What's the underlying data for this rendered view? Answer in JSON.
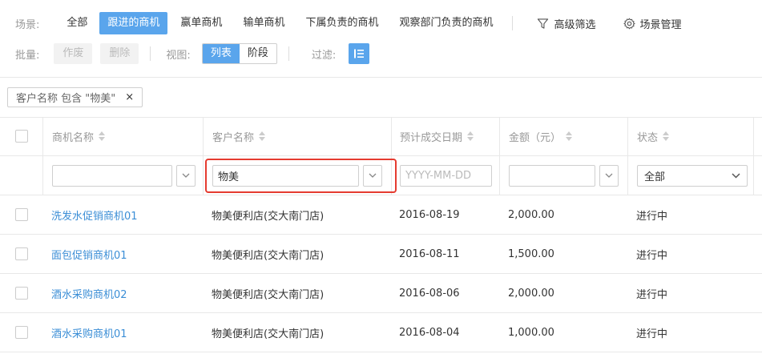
{
  "scene": {
    "label": "场景:",
    "items": [
      "全部",
      "跟进的商机",
      "赢单商机",
      "输单商机",
      "下属负责的商机",
      "观察部门负责的商机"
    ],
    "active_index": 1,
    "advanced_filter": "高级筛选",
    "scene_manage": "场景管理"
  },
  "batch": {
    "label": "批量:",
    "buttons": [
      "作废",
      "删除"
    ]
  },
  "view": {
    "label": "视图:",
    "options": [
      "列表",
      "阶段"
    ],
    "active_index": 0
  },
  "filter": {
    "label": "过滤:"
  },
  "active_filter_chip": {
    "text": "客户名称 包含 \"物美\"",
    "close": "×"
  },
  "table": {
    "headers": [
      "商机名称",
      "客户名称",
      "预计成交日期",
      "金额（元）",
      "状态"
    ],
    "filters": {
      "name_value": "",
      "customer_value": "物美",
      "date_placeholder": "YYYY-MM-DD",
      "amount_value": "",
      "status_value": "全部"
    },
    "rows": [
      {
        "name": "洗发水促销商机01",
        "customer": "物美便利店(交大南门店)",
        "date": "2016-08-19",
        "amount": "2,000.00",
        "status": "进行中"
      },
      {
        "name": "面包促销商机01",
        "customer": "物美便利店(交大南门店)",
        "date": "2016-08-11",
        "amount": "1,500.00",
        "status": "进行中"
      },
      {
        "name": "酒水采购商机02",
        "customer": "物美便利店(交大南门店)",
        "date": "2016-08-06",
        "amount": "2,000.00",
        "status": "进行中"
      },
      {
        "name": "酒水采购商机01",
        "customer": "物美便利店(交大南门店)",
        "date": "2016-08-04",
        "amount": "1,000.00",
        "status": "进行中"
      }
    ]
  },
  "colors": {
    "accent": "#5aa5ec",
    "link": "#3b8ed6",
    "highlight_border": "#e53b30"
  }
}
